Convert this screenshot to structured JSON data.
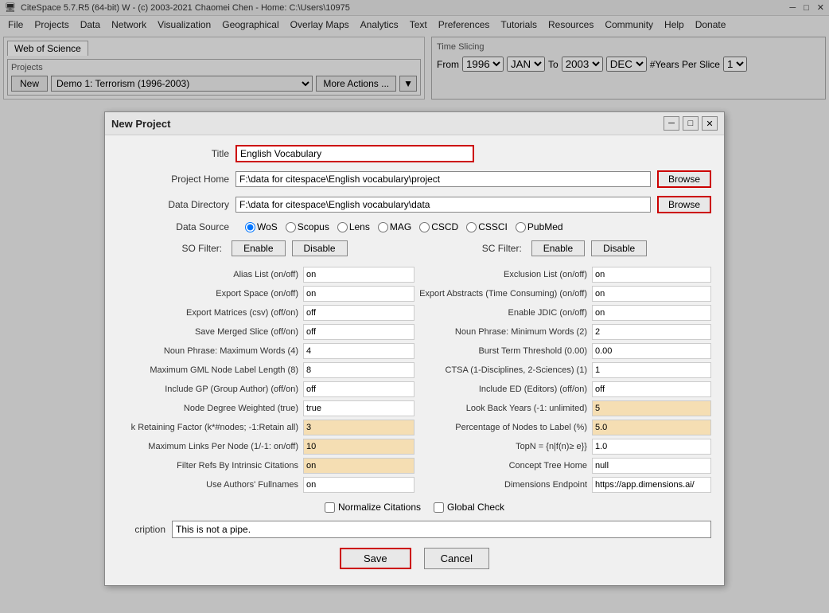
{
  "titlebar": {
    "text": "CiteSpace 5.7.R5 (64-bit) W - (c) 2003-2021 Chaomei Chen - Home: C:\\Users\\10975"
  },
  "menu": {
    "items": [
      "File",
      "Projects",
      "Data",
      "Network",
      "Visualization",
      "Geographical",
      "Overlay Maps",
      "Analytics",
      "Text",
      "Preferences",
      "Tutorials",
      "Resources",
      "Community",
      "Help",
      "Donate"
    ]
  },
  "wos": {
    "tab_label": "Web of Science",
    "projects_label": "Projects",
    "new_btn": "New",
    "project_value": "Demo 1: Terrorism (1996-2003)",
    "more_actions_btn": "More Actions ..."
  },
  "time_slicing": {
    "title": "Time Slicing",
    "from_label": "From",
    "from_year": "1996",
    "from_month": "JAN",
    "to_label": "To",
    "to_year": "2003",
    "to_month": "DEC",
    "years_per_slice_label": "#Years Per Slice",
    "years_per_slice_value": "1"
  },
  "dialog": {
    "title": "New Project",
    "title_label": "Title",
    "title_value": "English Vocabulary",
    "project_home_label": "Project Home",
    "project_home_value": "F:\\data for citespace\\English vocabulary\\project",
    "browse_btn1": "Browse",
    "data_dir_label": "Data Directory",
    "data_dir_value": "F:\\data for citespace\\English vocabulary\\data",
    "browse_btn2": "Browse",
    "data_source_label": "Data Source",
    "data_sources": [
      "WoS",
      "Scopus",
      "Lens",
      "MAG",
      "CSCD",
      "CSSCI",
      "PubMed"
    ],
    "data_source_selected": "WoS",
    "so_filter_label": "SO Filter:",
    "so_enable": "Enable",
    "so_disable": "Disable",
    "sc_filter_label": "SC Filter:",
    "sc_enable": "Enable",
    "sc_disable": "Disable",
    "props_left": [
      {
        "label": "Alias List (on/off)",
        "value": "on",
        "highlighted": false
      },
      {
        "label": "Export Space (on/off)",
        "value": "on",
        "highlighted": false
      },
      {
        "label": "Export Matrices (csv) (off/on)",
        "value": "off",
        "highlighted": false
      },
      {
        "label": "Save Merged Slice (off/on)",
        "value": "off",
        "highlighted": false
      },
      {
        "label": "Noun Phrase: Maximum Words (4)",
        "value": "4",
        "highlighted": false
      },
      {
        "label": "Maximum GML Node Label Length (8)",
        "value": "8",
        "highlighted": false
      },
      {
        "label": "Include GP (Group Author) (off/on)",
        "value": "off",
        "highlighted": false
      },
      {
        "label": "Node Degree Weighted (true)",
        "value": "true",
        "highlighted": false
      },
      {
        "label": "k Retaining Factor (k*#nodes; -1:Retain all)",
        "value": "3",
        "highlighted": true
      },
      {
        "label": "Maximum Links Per Node (1/-1: on/off)",
        "value": "10",
        "highlighted": true
      },
      {
        "label": "Filter Refs By Intrinsic Citations",
        "value": "on",
        "highlighted": true
      },
      {
        "label": "Use Authors' Fullnames",
        "value": "on",
        "highlighted": false
      }
    ],
    "props_right": [
      {
        "label": "Exclusion List (on/off)",
        "value": "on",
        "highlighted": false
      },
      {
        "label": "Export Abstracts (Time Consuming) (on/off)",
        "value": "on",
        "highlighted": false
      },
      {
        "label": "Enable JDIC (on/off)",
        "value": "on",
        "highlighted": false
      },
      {
        "label": "Noun Phrase: Minimum Words (2)",
        "value": "2",
        "highlighted": false
      },
      {
        "label": "Burst Term Threshold (0.00)",
        "value": "0.00",
        "highlighted": false
      },
      {
        "label": "CTSA (1-Disciplines, 2-Sciences) (1)",
        "value": "1",
        "highlighted": false
      },
      {
        "label": "Include ED (Editors) (off/on)",
        "value": "off",
        "highlighted": false
      },
      {
        "label": "Look Back Years (-1: unlimited)",
        "value": "5",
        "highlighted": true
      },
      {
        "label": "Percentage of Nodes to Label (%)",
        "value": "5.0",
        "highlighted": true
      },
      {
        "label": "TopN = {n|f(n)≥ e}}",
        "value": "1.0",
        "highlighted": false
      },
      {
        "label": "Concept Tree Home",
        "value": "null",
        "highlighted": false
      },
      {
        "label": "Dimensions Endpoint",
        "value": "https://app.dimensions.ai/",
        "highlighted": false
      }
    ],
    "normalize_label": "Normalize Citations",
    "global_check_label": "Global Check",
    "description_label": "cription",
    "description_value": "This is not a pipe.",
    "save_btn": "Save",
    "cancel_btn": "Cancel"
  }
}
